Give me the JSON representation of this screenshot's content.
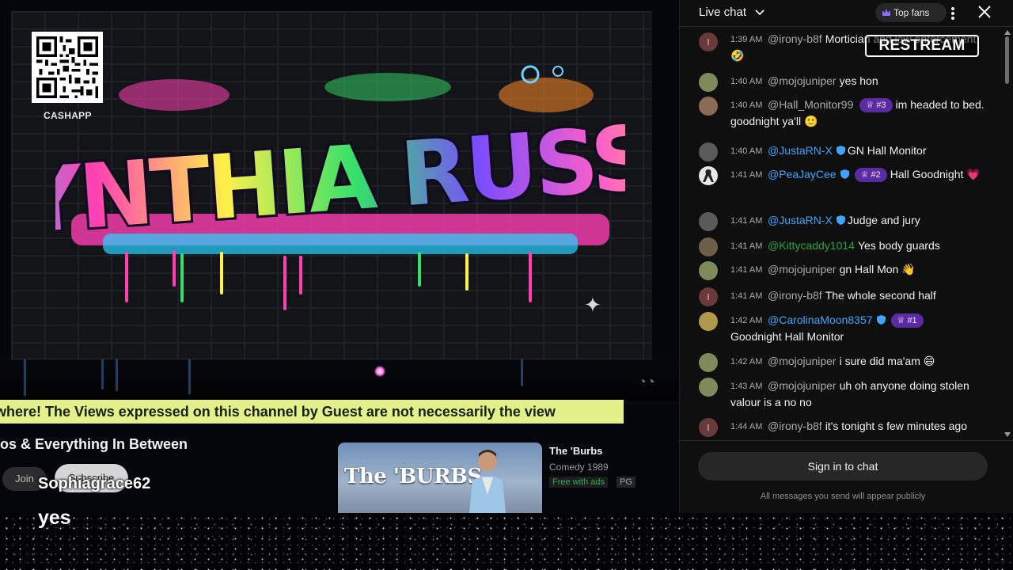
{
  "video": {
    "qr_label": "CASHAPP",
    "ticker_text": "where! The Views expressed on this channel by Guest are not necessarily the view",
    "channel_title": "os & Everything In Between",
    "join_label": "Join",
    "subscribe_label": "Subscribe",
    "overlay_username": "Sophiagrace62",
    "overlay_message": "yes",
    "graffiti_text": "CYNTHIA RUSSO"
  },
  "recommendation": {
    "thumb_title": "The 'BURBS",
    "title": "The 'Burbs",
    "meta": "Comedy 1989",
    "free_label": "Free with ads",
    "rating": "PG"
  },
  "chat": {
    "mode_label": "Live chat",
    "top_fans_label": "Top fans",
    "sign_in_label": "Sign in to chat",
    "public_note": "All messages you send will appear publicly",
    "restream_label": "RESTREAM",
    "messages": [
      {
        "time": "1:39 AM",
        "user": "@irony-b8f",
        "text": "Mortician and law enforcement",
        "emoji": "🤣",
        "avatar": "I"
      },
      {
        "time": "1:40 AM",
        "user": "@mojojuniper",
        "text": "yes hon",
        "avatar": "photo"
      },
      {
        "time": "1:40 AM",
        "user": "@Hall_Monitor99",
        "badge": "#3",
        "text": "im headed to bed. goodnight ya'll",
        "emoji": "🙂",
        "avatar": "photo"
      },
      {
        "time": "1:40 AM",
        "user": "@JustaRN-X",
        "text": "GN Hall Monitor",
        "avatar": "photo"
      },
      {
        "time": "1:41 AM",
        "user": "@PeaJayCee",
        "badge": "#2",
        "text": "Hall Goodnight",
        "emoji": "💗",
        "avatar": "ribbon"
      },
      {
        "time": "1:41 AM",
        "user": "@JustaRN-X",
        "text": "Judge and jury",
        "avatar": "photo"
      },
      {
        "time": "1:41 AM",
        "user": "@Kittycaddy1014",
        "text": "Yes body guards",
        "avatar": "photo"
      },
      {
        "time": "1:41 AM",
        "user": "@mojojuniper",
        "text": "gn Hall Mon",
        "emoji": "👋",
        "avatar": "photo"
      },
      {
        "time": "1:41 AM",
        "user": "@irony-b8f",
        "text": "The whole second half",
        "avatar": "I"
      },
      {
        "time": "1:42 AM",
        "user": "@CarolinaMoon8357",
        "badge": "#1",
        "text": "Goodnight Hall Monitor",
        "avatar": "photo"
      },
      {
        "time": "1:42 AM",
        "user": "@mojojuniper",
        "text": "i sure did ma'am",
        "emoji": "😄",
        "avatar": "photo"
      },
      {
        "time": "1:43 AM",
        "user": "@mojojuniper",
        "text": "uh oh anyone doing stolen valour is a no no",
        "avatar": "photo"
      },
      {
        "time": "1:44 AM",
        "user": "@irony-b8f",
        "text": "it's tonight s few minutes ago",
        "avatar": "I"
      }
    ]
  },
  "colors": {
    "ticker_bg": "#e4f08a",
    "chat_bg": "#0f0f0f",
    "crown_badge": "#5b2ba3",
    "moderator_blue": "#3ea6ff",
    "member_green": "#2ba640"
  }
}
